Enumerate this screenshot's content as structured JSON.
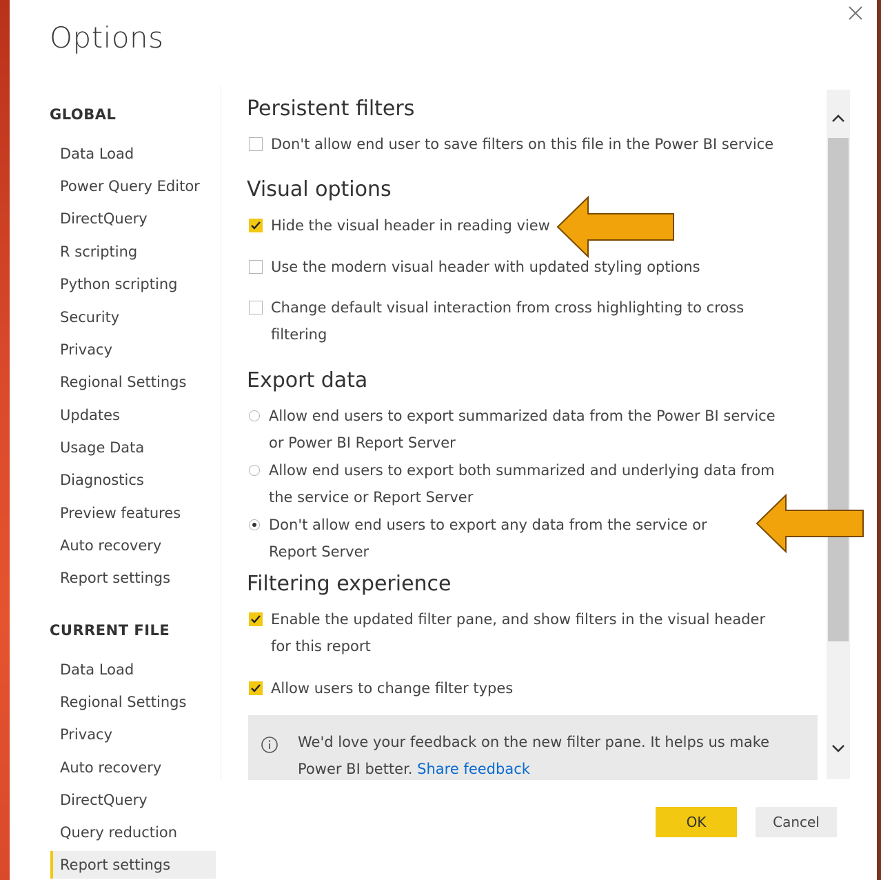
{
  "dialog": {
    "title": "Options",
    "close_icon": "close-icon"
  },
  "sidebar": {
    "global_heading": "GLOBAL",
    "global_items": [
      {
        "label": "Data Load"
      },
      {
        "label": "Power Query Editor"
      },
      {
        "label": "DirectQuery"
      },
      {
        "label": "R scripting"
      },
      {
        "label": "Python scripting"
      },
      {
        "label": "Security"
      },
      {
        "label": "Privacy"
      },
      {
        "label": "Regional Settings"
      },
      {
        "label": "Updates"
      },
      {
        "label": "Usage Data"
      },
      {
        "label": "Diagnostics"
      },
      {
        "label": "Preview features"
      },
      {
        "label": "Auto recovery"
      },
      {
        "label": "Report settings"
      }
    ],
    "current_heading": "CURRENT FILE",
    "current_items": [
      {
        "label": "Data Load"
      },
      {
        "label": "Regional Settings"
      },
      {
        "label": "Privacy"
      },
      {
        "label": "Auto recovery"
      },
      {
        "label": "DirectQuery"
      },
      {
        "label": "Query reduction"
      },
      {
        "label": "Report settings",
        "selected": true
      }
    ]
  },
  "content": {
    "persistent_filters": {
      "title": "Persistent filters",
      "options": [
        {
          "label": "Don't allow end user to save filters on this file in the Power BI service",
          "checked": false
        }
      ]
    },
    "visual_options": {
      "title": "Visual options",
      "options": [
        {
          "label": "Hide the visual header in reading view",
          "checked": true
        },
        {
          "label": "Use the modern visual header with updated styling options",
          "checked": false
        },
        {
          "label": "Change default visual interaction from cross highlighting to cross filtering",
          "checked": false
        }
      ]
    },
    "export_data": {
      "title": "Export data",
      "options": [
        {
          "label": "Allow end users to export summarized data from the Power BI service or Power BI Report Server",
          "selected": false
        },
        {
          "label": "Allow end users to export both summarized and underlying data from the service or Report Server",
          "selected": false
        },
        {
          "label": "Don't allow end users to export any data from the service or Report Server",
          "selected": true
        }
      ]
    },
    "filtering_experience": {
      "title": "Filtering experience",
      "options": [
        {
          "label": "Enable the updated filter pane, and show filters in the visual header for this report",
          "checked": true
        },
        {
          "label": "Allow users to change filter types",
          "checked": true
        }
      ]
    },
    "feedback": {
      "text": "We'd love your feedback on the new filter pane. It helps us make Power BI better.",
      "link": "Share feedback",
      "icon": "info-icon"
    }
  },
  "buttons": {
    "ok": "OK",
    "cancel": "Cancel"
  },
  "annotations": {
    "arrow_color": "#f0a30a",
    "arrow_icon": "left-arrow-icon"
  },
  "colors": {
    "accent": "#f2c811",
    "link": "#0b6bd0",
    "background_frame": "#c9401f"
  }
}
